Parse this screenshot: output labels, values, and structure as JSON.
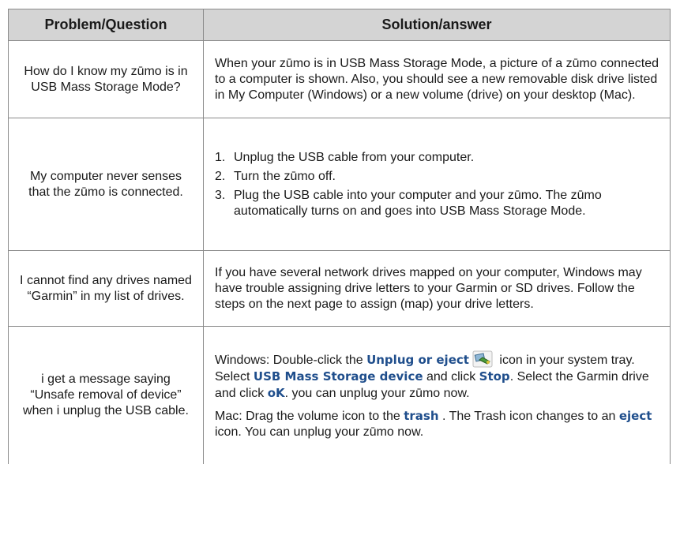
{
  "headers": {
    "col1": "Problem/Question",
    "col2": "Solution/answer"
  },
  "rows": [
    {
      "question": "How do I know my zūmo is in USB Mass Storage Mode?",
      "answer": "When your zūmo is in USB Mass Storage Mode, a picture of a zūmo connected to a computer is shown. Also, you should see a new removable disk drive listed in My Computer (Windows) or a new volume (drive) on your desktop (Mac)."
    },
    {
      "question": "My computer never senses that the zūmo is connected.",
      "steps": [
        {
          "num": "1.",
          "text": "Unplug the USB cable from your computer."
        },
        {
          "num": "2.",
          "text": "Turn the zūmo off."
        },
        {
          "num": "3.",
          "text": "Plug the USB cable into your computer and your zūmo. The zūmo automatically turns on and goes into USB Mass Storage Mode."
        }
      ]
    },
    {
      "question": "I cannot find any drives named “Garmin” in my list of drives.",
      "answer": "If you have several network drives mapped on your computer, Windows may have trouble assigning drive letters to your Garmin or SD drives. Follow the steps on the next page to assign (map) your drive letters."
    },
    {
      "question": "i get a message saying “Unsafe removal of device” when i unplug the USB cable.",
      "windows": {
        "t1": "Windows: Double-click the ",
        "k1": "Unplug or eject",
        "t2": " icon in your system tray. Select ",
        "k2": "USB Mass Storage device",
        "t3": " and click ",
        "k3": "Stop",
        "t4": ". Select the Garmin drive and click ",
        "k4": "oK",
        "t5": ". you can unplug your zūmo now."
      },
      "mac": {
        "t1": "Mac: Drag the volume icon to the ",
        "k1": "trash",
        "t2": " . The Trash icon changes to an ",
        "k2": "eject",
        "t3": " icon. You can unplug your zūmo now."
      },
      "icon": "unplug-eject-icon"
    }
  ],
  "colors": {
    "header_bg": "#d4d4d4",
    "keyword": "#1f4e8c",
    "border": "#8a8a8a"
  }
}
